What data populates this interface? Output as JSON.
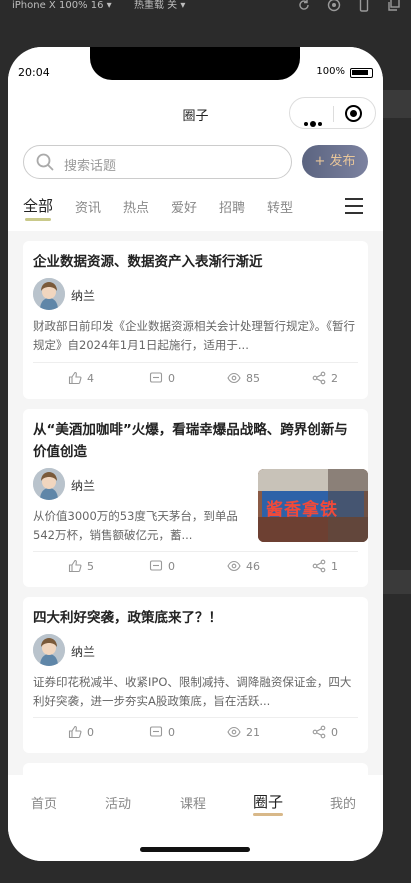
{
  "devtools": {
    "device_label": "iPhone X 100% 16 ▾",
    "reload_label": "热重载 关 ▾"
  },
  "status": {
    "time": "20:04",
    "battery": "100%"
  },
  "navbar": {
    "title": "圈子"
  },
  "search": {
    "placeholder": "搜索话题",
    "publish_label": "+ 发布"
  },
  "tabs": [
    "全部",
    "资讯",
    "热点",
    "爱好",
    "招聘",
    "转型"
  ],
  "active_tab": "全部",
  "posts": [
    {
      "title": "企业数据资源、数据资产入表渐行渐近",
      "author": "纳兰",
      "summary": "财政部日前印发《企业数据资源相关会计处理暂行规定》。《暂行规定》自2024年1月1日起施行，适用于...",
      "likes": "4",
      "comments": "0",
      "views": "85",
      "shares": "2",
      "has_image": false
    },
    {
      "title": "从“美酒加咖啡”火爆，看瑞幸爆品战略、跨界创新与价值创造",
      "author": "纳兰",
      "summary": "从价值3000万的53度飞天茅台，到单品542万杯，销售额破亿元，蓄...",
      "likes": "5",
      "comments": "0",
      "views": "46",
      "shares": "1",
      "has_image": true,
      "image_text": "酱香拿铁"
    },
    {
      "title": "四大利好突袭，政策底来了？！",
      "author": "纳兰",
      "summary": "证券印花税减半、收紧IPO、限制减持、调降融资保证金，四大利好突袭，进一步夯实A股政策底，旨在活跃...",
      "likes": "0",
      "comments": "0",
      "views": "21",
      "shares": "0",
      "has_image": false
    }
  ],
  "bottom_nav": [
    "首页",
    "活动",
    "课程",
    "圈子",
    "我的"
  ],
  "active_bottom": "圈子",
  "colors": {
    "accent_gold": "#d8b889",
    "publish_bg": "#5b6480",
    "tab_underline": "#c9c98a"
  }
}
